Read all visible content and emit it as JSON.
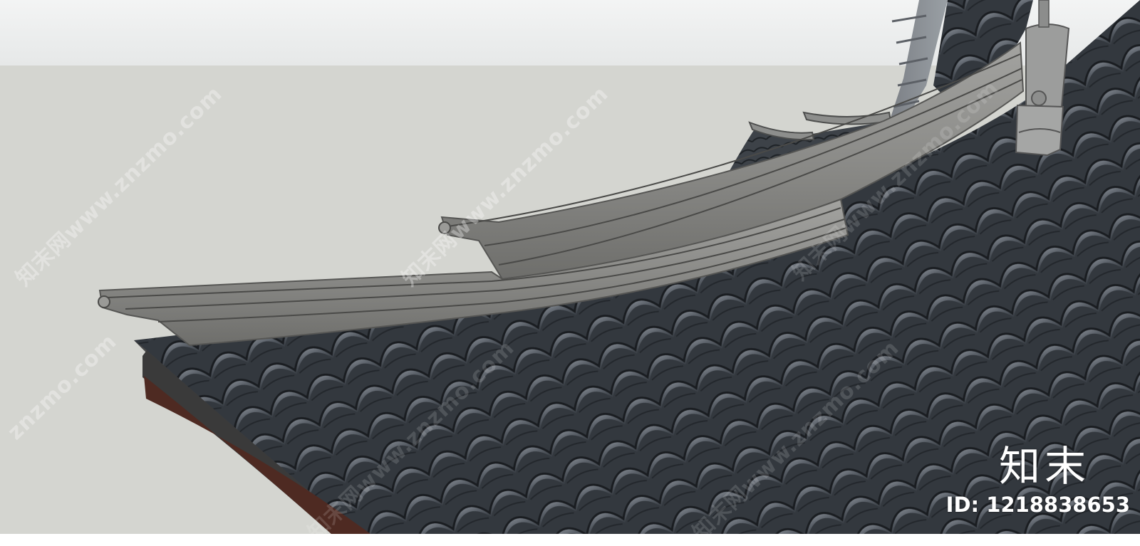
{
  "scene": {
    "subject": "Chinese traditional roof, grey clay tiles and curved stone ridge",
    "colors": {
      "sky": "#eef0f0",
      "ground": "#d4d5d0",
      "tile_base": "#3f444b",
      "tile_highlight": "#6e747b",
      "ridge": "#8c8c8a",
      "fascia": "#3b3b3b",
      "wood_trim": "#4e2a22"
    }
  },
  "watermark": {
    "text": "知末网www.znzmo.com",
    "text_short": "znzmo.com"
  },
  "brand": {
    "logo": "知末",
    "id_label": "ID: 1218838653"
  }
}
